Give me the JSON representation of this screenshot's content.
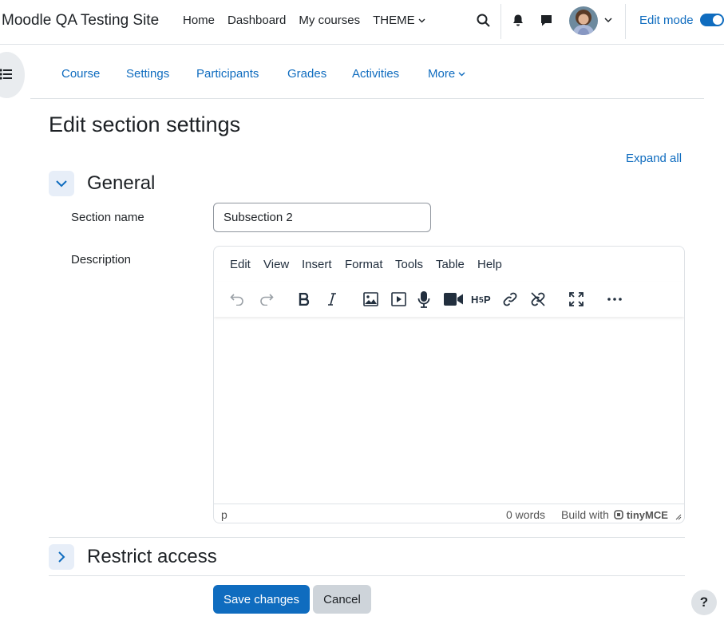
{
  "navbar": {
    "site_name": "Moodle QA Testing Site",
    "items": [
      "Home",
      "Dashboard",
      "My courses",
      "THEME"
    ],
    "edit_mode_label": "Edit mode",
    "edit_mode_on": true
  },
  "secondary_nav": {
    "items": [
      "Course",
      "Settings",
      "Participants",
      "Grades",
      "Activities",
      "More"
    ]
  },
  "page": {
    "title": "Edit section settings",
    "expand_all": "Expand all"
  },
  "general": {
    "heading": "General",
    "section_name_label": "Section name",
    "section_name_value": "Subsection 2",
    "description_label": "Description"
  },
  "editor": {
    "menu": [
      "Edit",
      "View",
      "Insert",
      "Format",
      "Tools",
      "Table",
      "Help"
    ],
    "toolbar_icons": [
      "undo-icon",
      "redo-icon",
      "bold-icon",
      "italic-icon",
      "image-icon",
      "media-icon",
      "record-audio-icon",
      "record-video-icon",
      "h5p-icon",
      "link-icon",
      "unlink-icon",
      "fullscreen-icon",
      "more-icon"
    ],
    "status_path": "p",
    "word_count": "0 words",
    "build_with": "Build with",
    "brand": "tinyMCE"
  },
  "restrict": {
    "heading": "Restrict access"
  },
  "buttons": {
    "save": "Save changes",
    "cancel": "Cancel",
    "help": "?"
  },
  "colors": {
    "primary": "#0f6cbf",
    "secondary_button": "#ced4da"
  }
}
